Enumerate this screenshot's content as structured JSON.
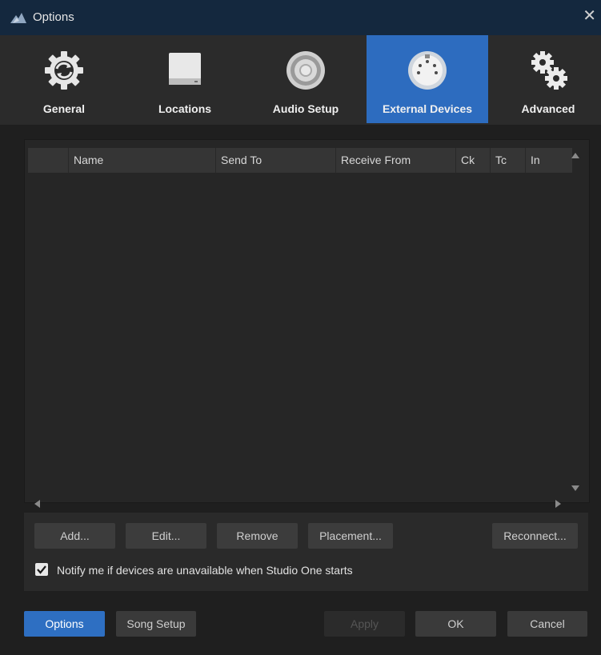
{
  "window": {
    "title": "Options",
    "close_glyph": "✕"
  },
  "tabs": [
    {
      "label": "General",
      "icon": "gear-refresh-icon"
    },
    {
      "label": "Locations",
      "icon": "drive-icon"
    },
    {
      "label": "Audio Setup",
      "icon": "speaker-icon"
    },
    {
      "label": "External Devices",
      "icon": "midi-connector-icon",
      "active": true
    },
    {
      "label": "Advanced",
      "icon": "gears-icon"
    }
  ],
  "device_table": {
    "columns": [
      "Name",
      "Send To",
      "Receive From",
      "Ck",
      "Tc",
      "In"
    ],
    "rows": []
  },
  "actions": {
    "add": "Add...",
    "edit": "Edit...",
    "remove": "Remove",
    "placement": "Placement...",
    "reconnect": "Reconnect...",
    "notify_label": "Notify me if devices are unavailable when Studio One starts",
    "notify_checked": true
  },
  "footer": {
    "options": "Options",
    "song_setup": "Song Setup",
    "apply": "Apply",
    "ok": "OK",
    "cancel": "Cancel"
  },
  "colors": {
    "accent": "#2d6cbf",
    "titlebar": "#14283e",
    "toolbar": "#2b2b2b",
    "panel": "#262626"
  }
}
